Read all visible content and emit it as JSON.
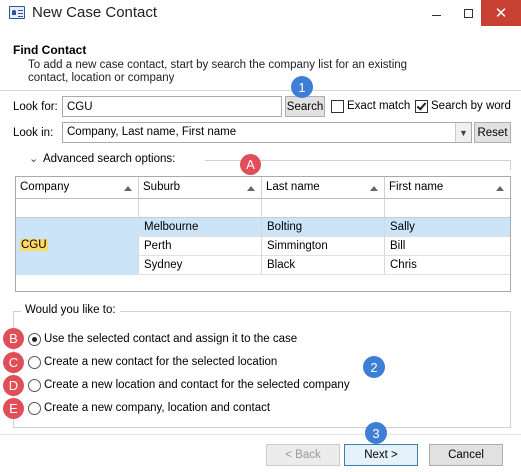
{
  "window": {
    "title": "New Case Contact"
  },
  "header": {
    "title": "Find Contact",
    "description": "To add a new case contact, start by search the company list for an existing contact, location or company"
  },
  "search": {
    "look_for_label": "Look for:",
    "look_for_value": "CGU",
    "search_button": "Search",
    "exact_match_label": "Exact match",
    "exact_match_checked": false,
    "search_by_word_label": "Search by word",
    "search_by_word_checked": true,
    "look_in_label": "Look in:",
    "look_in_value": "Company, Last name, First name",
    "reset_button": "Reset",
    "advanced_label": "Advanced search options:"
  },
  "grid": {
    "columns": [
      "Company",
      "Suburb",
      "Last name",
      "First name"
    ],
    "group_company": "CGU",
    "rows": [
      {
        "suburb": "Melbourne",
        "last_name": "Bolting",
        "first_name": "Sally",
        "selected": true
      },
      {
        "suburb": "Perth",
        "last_name": "Simmington",
        "first_name": "Bill",
        "selected": false
      },
      {
        "suburb": "Sydney",
        "last_name": "Black",
        "first_name": "Chris",
        "selected": false
      }
    ]
  },
  "options": {
    "group_label": "Would you like to:",
    "items": [
      {
        "label": "Use the selected contact and assign it to the case",
        "selected": true
      },
      {
        "label": "Create a new contact for the selected location",
        "selected": false
      },
      {
        "label": "Create a new location and contact for the selected company",
        "selected": false
      },
      {
        "label": "Create a new company, location and contact",
        "selected": false
      }
    ]
  },
  "footer": {
    "back": "< Back",
    "next": "Next >",
    "cancel": "Cancel"
  },
  "badges": {
    "n1": "1",
    "n2": "2",
    "n3": "3",
    "a": "A",
    "b": "B",
    "c": "C",
    "d": "D",
    "e": "E"
  },
  "colors": {
    "selection": "#cce4f7",
    "highlight": "#ffd966",
    "badge_blue": "#3e7fd6",
    "badge_red": "#e04f57",
    "close": "#c84031"
  }
}
